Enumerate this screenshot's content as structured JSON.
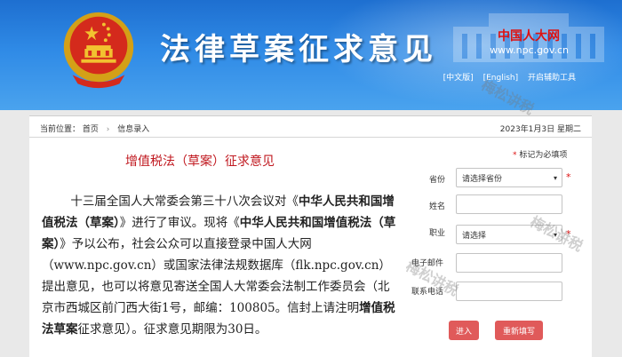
{
  "header": {
    "site_title": "法律草案征求意见",
    "npc_logo": "中国人大网",
    "npc_url": "www.npc.gov.cn",
    "links": [
      "[中文版]",
      "[English]",
      "开启辅助工具"
    ]
  },
  "breadcrumb": {
    "label": "当前位置：",
    "items": [
      "首页",
      "信息录入"
    ]
  },
  "date": "2023年1月3日 星期二",
  "law": {
    "title": "增值税法（草案）征求意见",
    "body": [
      {
        "t": "十三届全国人大常委会第三十八次会议对《",
        "b": false
      },
      {
        "t": "中华人民共和国增值税法（草案）",
        "b": true
      },
      {
        "t": "》进行了审议。现将《",
        "b": false
      },
      {
        "t": "中华人民共和国增值税法（草案）",
        "b": true
      },
      {
        "t": "》予以公布，社会公众可以直接登录中国人大网（www.npc.gov.cn）或国家法律法规数据库（flk.npc.gov.cn）提出意见，也可以将意见寄送全国人大常委会法制工作委员会（北京市西城区前门西大街1号，邮编：100805。信封上请注明",
        "b": false
      },
      {
        "t": "增值税法草案",
        "b": true
      },
      {
        "t": "征求意见）。征求意见期限为30日。",
        "b": false
      }
    ]
  },
  "form": {
    "required_note": "标记为必填项",
    "province_label": "省份",
    "province_value": "请选择省份",
    "name_label": "姓名",
    "name_value": "",
    "job_label": "职业",
    "job_value": "请选择",
    "email_label": "电子邮件",
    "email_value": "",
    "phone_label": "联系电话",
    "phone_value": "",
    "submit_label": "进入",
    "reset_label": "重新填写"
  },
  "watermark": [
    "梅松讲税",
    "梅松讲税",
    "梅松讲税"
  ],
  "colors": {
    "header_blue": "#2f8ae6",
    "title_red": "#c0181f",
    "button_red": "#e05a5a"
  }
}
